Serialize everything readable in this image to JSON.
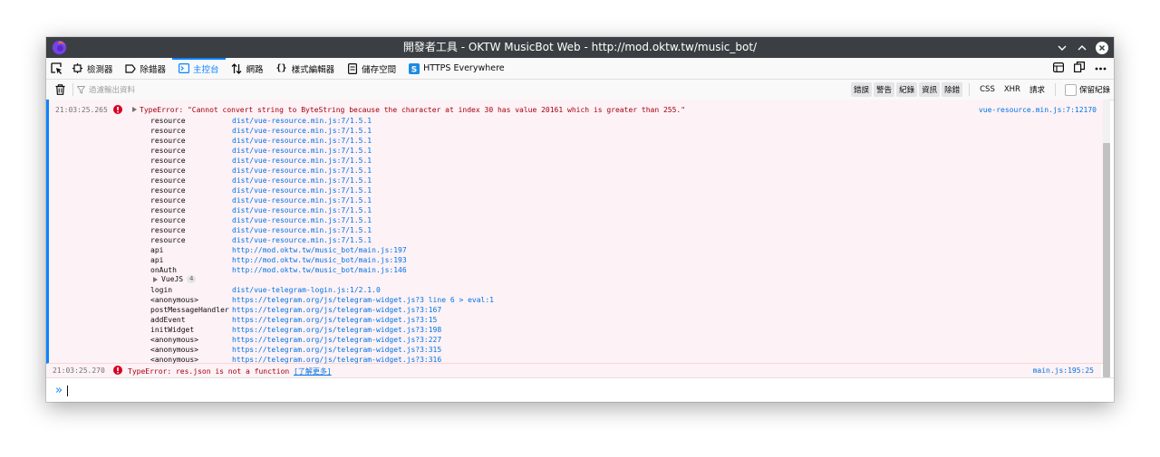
{
  "window": {
    "title": "開發者工具 - OKTW MusicBot Web - http://mod.oktw.tw/music_bot/"
  },
  "toolbar": {
    "tabs": [
      {
        "label": "檢測器",
        "icon": "inspector-icon"
      },
      {
        "label": "除錯器",
        "icon": "debugger-icon"
      },
      {
        "label": "主控台",
        "icon": "console-icon",
        "selected": true
      },
      {
        "label": "網路",
        "icon": "network-icon"
      },
      {
        "label": "樣式編輯器",
        "icon": "style-editor-icon"
      },
      {
        "label": "儲存空間",
        "icon": "storage-icon"
      },
      {
        "label": "HTTPS Everywhere",
        "icon": "https-everywhere-icon"
      }
    ]
  },
  "filter": {
    "placeholder": "過濾輸出資料",
    "levels": [
      "錯誤",
      "警告",
      "紀錄",
      "資訊",
      "除錯"
    ],
    "requests": [
      "CSS",
      "XHR",
      "請求"
    ],
    "persist_label": "保留紀錄"
  },
  "console": {
    "messages": [
      {
        "timestamp": "21:03:25.265",
        "text": "TypeError: \"Cannot convert string to ByteString because the character at index 30 has value 20161 which is greater than 255.\"",
        "location": "vue-resource.min.js:7:12170",
        "frames": [
          {
            "fn": "resource",
            "src": "dist/vue-resource.min.js:7/1.5.1"
          },
          {
            "fn": "resource",
            "src": "dist/vue-resource.min.js:7/1.5.1"
          },
          {
            "fn": "resource",
            "src": "dist/vue-resource.min.js:7/1.5.1"
          },
          {
            "fn": "resource",
            "src": "dist/vue-resource.min.js:7/1.5.1"
          },
          {
            "fn": "resource",
            "src": "dist/vue-resource.min.js:7/1.5.1"
          },
          {
            "fn": "resource",
            "src": "dist/vue-resource.min.js:7/1.5.1"
          },
          {
            "fn": "resource",
            "src": "dist/vue-resource.min.js:7/1.5.1"
          },
          {
            "fn": "resource",
            "src": "dist/vue-resource.min.js:7/1.5.1"
          },
          {
            "fn": "resource",
            "src": "dist/vue-resource.min.js:7/1.5.1"
          },
          {
            "fn": "resource",
            "src": "dist/vue-resource.min.js:7/1.5.1"
          },
          {
            "fn": "resource",
            "src": "dist/vue-resource.min.js:7/1.5.1"
          },
          {
            "fn": "resource",
            "src": "dist/vue-resource.min.js:7/1.5.1"
          },
          {
            "fn": "resource",
            "src": "dist/vue-resource.min.js:7/1.5.1"
          },
          {
            "fn": "api",
            "src": "http://mod.oktw.tw/music_bot/main.js:197"
          },
          {
            "fn": "api",
            "src": "http://mod.oktw.tw/music_bot/main.js:193"
          },
          {
            "fn": "onAuth",
            "src": "http://mod.oktw.tw/music_bot/main.js:146"
          },
          {
            "fn": "",
            "src": "",
            "group": "VueJS",
            "count": "4"
          },
          {
            "fn": "login",
            "src": "dist/vue-telegram-login.js:1/2.1.0"
          },
          {
            "fn": "<anonymous>",
            "src": "https://telegram.org/js/telegram-widget.js?3 line 6 > eval:1"
          },
          {
            "fn": "postMessageHandler",
            "src": "https://telegram.org/js/telegram-widget.js?3:167"
          },
          {
            "fn": "addEvent",
            "src": "https://telegram.org/js/telegram-widget.js?3:15"
          },
          {
            "fn": "initWidget",
            "src": "https://telegram.org/js/telegram-widget.js?3:198"
          },
          {
            "fn": "<anonymous>",
            "src": "https://telegram.org/js/telegram-widget.js?3:227"
          },
          {
            "fn": "<anonymous>",
            "src": "https://telegram.org/js/telegram-widget.js?3:315"
          },
          {
            "fn": "<anonymous>",
            "src": "https://telegram.org/js/telegram-widget.js?3:316"
          }
        ]
      },
      {
        "timestamp": "21:03:25.270",
        "text": "TypeError: res.json is not a function",
        "learn_more": "[了解更多]",
        "location": "main.js:195:25"
      }
    ],
    "prompt": "»"
  },
  "colors": {
    "accent": "#0a84ff",
    "error_text": "#a4000f",
    "error_bg": "#fdf2f5",
    "link": "#0074e8"
  }
}
